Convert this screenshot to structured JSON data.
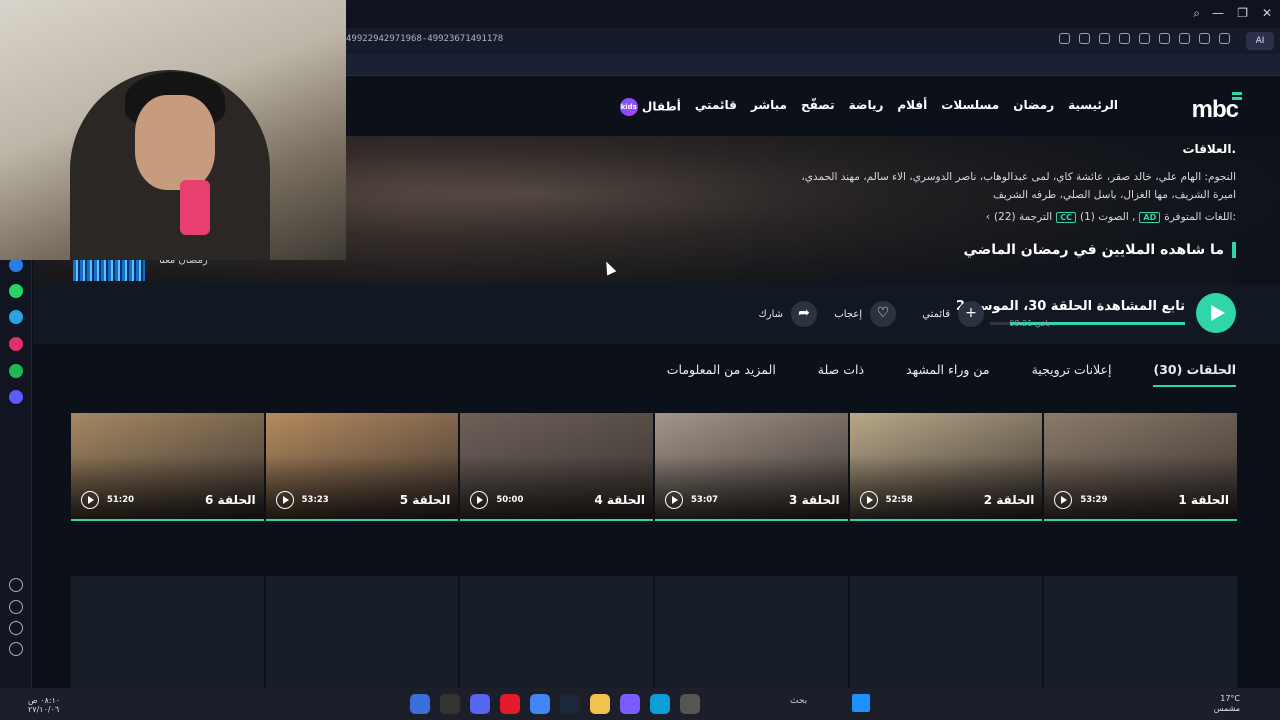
{
  "browser": {
    "url": "49922942971968-499236714911​78",
    "ai_label": "AI",
    "window_controls": [
      "search-icon",
      "minimize-icon",
      "maximize-icon",
      "close-icon"
    ]
  },
  "site": {
    "logo": "mbc",
    "nav": [
      "الرئيسية",
      "رمضان",
      "مسلسلات",
      "أفلام",
      "رياضة",
      "تصفّح",
      "مباشر",
      "قائمتي",
      "أطفال"
    ],
    "kids_badge": "kids"
  },
  "show": {
    "desc_end": "العلاقات.",
    "stars": "النجوم: الهام علي، خالد صقر، عائشة كاي، لمى عبدالوهاب، ناصر الدوسري، الاء سالم، مهند الحمدي، اميرة الشريف، مها الغزال، باسل الصلي، طرفه الشريف",
    "langs_label": "اللغات المتوفرة:",
    "ad_tag": "AD",
    "audio": "الصوت (1) ,",
    "cc_tag": "CC",
    "subtitles": "الترجمة (22)",
    "popular_heading": "ما شاهده الملايين في رمضان الماضي",
    "strip_label": "رمضان معنا"
  },
  "player": {
    "continue_label": "تابع المشاهدة الحلقة 30، الموسم 2",
    "remaining": "08:21 باقي",
    "progress": 0.9,
    "my_list": "قائمتي",
    "like": "إعجاب",
    "share": "شارك"
  },
  "tabs": [
    "الحلقات (30)",
    "إعلانات ترويجية",
    "من وراء المشهد",
    "ذات صلة",
    "المزيد من المعلومات"
  ],
  "episodes": [
    {
      "title": "الحلقة 1",
      "duration": "53:29",
      "color": "#8a7a6a"
    },
    {
      "title": "الحلقة 2",
      "duration": "52:58",
      "color": "#b8a888"
    },
    {
      "title": "الحلقة 3",
      "duration": "53:07",
      "color": "#a2968a"
    },
    {
      "title": "الحلقة 4",
      "duration": "50:00",
      "color": "#6c6058"
    },
    {
      "title": "الحلقة 5",
      "duration": "53:23",
      "color": "#b58a5e"
    },
    {
      "title": "الحلقة 6",
      "duration": "51:20",
      "color": "#a58862"
    }
  ],
  "taskbar": {
    "time": "٠٨:١٠ ص",
    "date": "٢٧/١٠/٠٦",
    "search": "بحث",
    "weather_temp": "17°C",
    "weather_desc": "مشمس"
  }
}
